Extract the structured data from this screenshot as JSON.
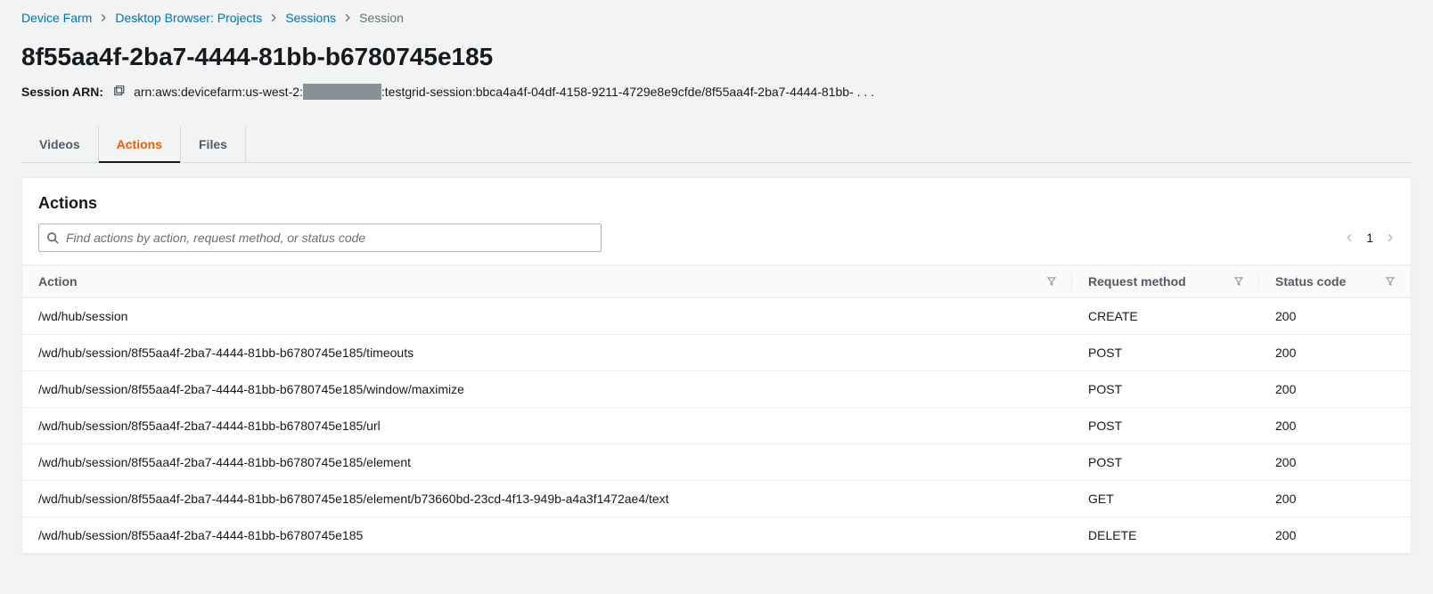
{
  "breadcrumb": {
    "items": [
      {
        "label": "Device Farm"
      },
      {
        "label": "Desktop Browser: Projects"
      },
      {
        "label": "Sessions"
      }
    ],
    "current": "Session"
  },
  "page": {
    "title": "8f55aa4f-2ba7-4444-81bb-b6780745e185",
    "arn_label": "Session ARN:",
    "arn_prefix": "arn:aws:devicefarm:us-west-2:",
    "arn_suffix": ":testgrid-session:bbca4a4f-04df-4158-9211-4729e8e9cfde/8f55aa4f-2ba7-4444-81bb- . . ."
  },
  "tabs": [
    {
      "id": "videos",
      "label": "Videos",
      "active": false
    },
    {
      "id": "actions",
      "label": "Actions",
      "active": true
    },
    {
      "id": "files",
      "label": "Files",
      "active": false
    }
  ],
  "panel": {
    "title": "Actions",
    "search_placeholder": "Find actions by action, request method, or status code",
    "page_number": "1"
  },
  "columns": {
    "action": "Action",
    "method": "Request method",
    "status": "Status code"
  },
  "rows": [
    {
      "action": "/wd/hub/session",
      "method": "CREATE",
      "status": "200"
    },
    {
      "action": "/wd/hub/session/8f55aa4f-2ba7-4444-81bb-b6780745e185/timeouts",
      "method": "POST",
      "status": "200"
    },
    {
      "action": "/wd/hub/session/8f55aa4f-2ba7-4444-81bb-b6780745e185/window/maximize",
      "method": "POST",
      "status": "200"
    },
    {
      "action": "/wd/hub/session/8f55aa4f-2ba7-4444-81bb-b6780745e185/url",
      "method": "POST",
      "status": "200"
    },
    {
      "action": "/wd/hub/session/8f55aa4f-2ba7-4444-81bb-b6780745e185/element",
      "method": "POST",
      "status": "200"
    },
    {
      "action": "/wd/hub/session/8f55aa4f-2ba7-4444-81bb-b6780745e185/element/b73660bd-23cd-4f13-949b-a4a3f1472ae4/text",
      "method": "GET",
      "status": "200"
    },
    {
      "action": "/wd/hub/session/8f55aa4f-2ba7-4444-81bb-b6780745e185",
      "method": "DELETE",
      "status": "200"
    }
  ]
}
